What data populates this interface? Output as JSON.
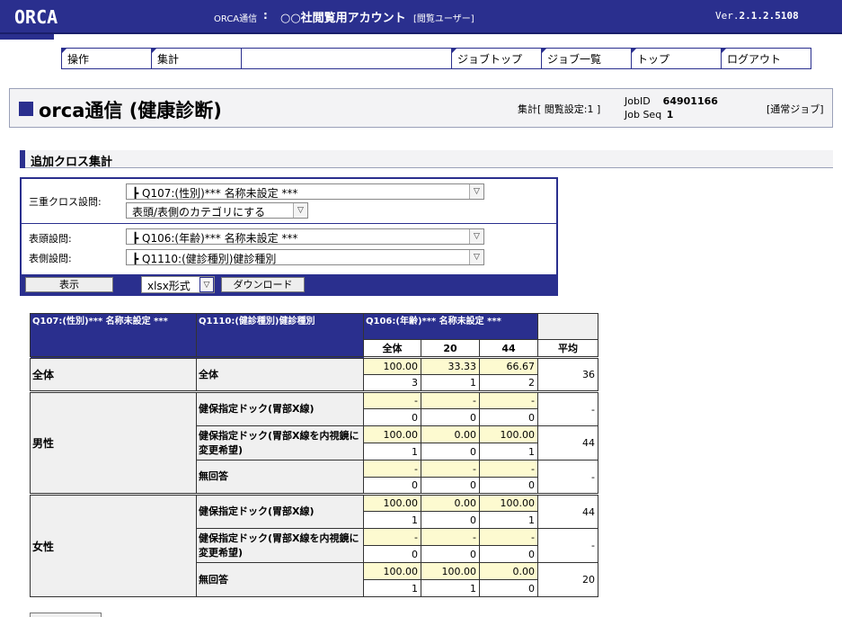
{
  "header": {
    "logo": "ORCA",
    "service": "ORCA通信",
    "separator": ":",
    "account": "○○社閲覧用アカウント",
    "role": "[閲覧ユーザー]",
    "version_prefix": "Ver.",
    "version": "2.1.2.5108"
  },
  "menu": {
    "ops": "操作",
    "agg": "集計",
    "job_top": "ジョブトップ",
    "job_list": "ジョブ一覧",
    "top": "トップ",
    "logout": "ログアウト"
  },
  "title": {
    "main": "orca通信 (健康診断)",
    "count": "集計[ 閲覧設定:1 ]",
    "job_id_label": "JobID",
    "job_id": "64901166",
    "job_seq_label": "Job Seq",
    "job_seq": "1",
    "job_type": "[通常ジョブ]"
  },
  "section": {
    "title": "追加クロス集計"
  },
  "form": {
    "triple_label": "三重クロス設問:",
    "triple_value": "┣ Q107:(性別)*** 名称未設定 ***",
    "category_value": "表頭/表側のカテゴリにする",
    "head_label": "表頭設問:",
    "head_value": "┣ Q106:(年齢)*** 名称未設定 ***",
    "side_label": "表側設問:",
    "side_value": "┣ Q1110:(健診種別)健診種別",
    "show_button": "表示",
    "format_value": "xlsx形式",
    "download_button": "ダウンロード"
  },
  "table": {
    "col1_header": "Q107:(性別)*** 名称未設定 ***",
    "col2_header": "Q1110:(健診種別)健診種別",
    "col3_header": "Q106:(年齢)*** 名称未設定 ***",
    "sub_headers": [
      "全体",
      "20",
      "44"
    ],
    "avg_header": "平均",
    "groups": [
      {
        "label": "全体",
        "rows": [
          {
            "label": "全体",
            "pct": [
              "100.00",
              "33.33",
              "66.67"
            ],
            "num": [
              "3",
              "1",
              "2"
            ],
            "avg": "36"
          }
        ]
      },
      {
        "label": "男性",
        "rows": [
          {
            "label": "健保指定ドック(胃部X線)",
            "pct": [
              "-",
              "-",
              "-"
            ],
            "num": [
              "0",
              "0",
              "0"
            ],
            "avg": "-"
          },
          {
            "label": "健保指定ドック(胃部X線を内視鏡に変更希望)",
            "pct": [
              "100.00",
              "0.00",
              "100.00"
            ],
            "num": [
              "1",
              "0",
              "1"
            ],
            "avg": "44"
          },
          {
            "label": "無回答",
            "pct": [
              "-",
              "-",
              "-"
            ],
            "num": [
              "0",
              "0",
              "0"
            ],
            "avg": "-"
          }
        ]
      },
      {
        "label": "女性",
        "rows": [
          {
            "label": "健保指定ドック(胃部X線)",
            "pct": [
              "100.00",
              "0.00",
              "100.00"
            ],
            "num": [
              "1",
              "0",
              "1"
            ],
            "avg": "44"
          },
          {
            "label": "健保指定ドック(胃部X線を内視鏡に変更希望)",
            "pct": [
              "-",
              "-",
              "-"
            ],
            "num": [
              "0",
              "0",
              "0"
            ],
            "avg": "-"
          },
          {
            "label": "無回答",
            "pct": [
              "100.00",
              "100.00",
              "0.00"
            ],
            "num": [
              "1",
              "1",
              "0"
            ],
            "avg": "20"
          }
        ]
      }
    ]
  }
}
